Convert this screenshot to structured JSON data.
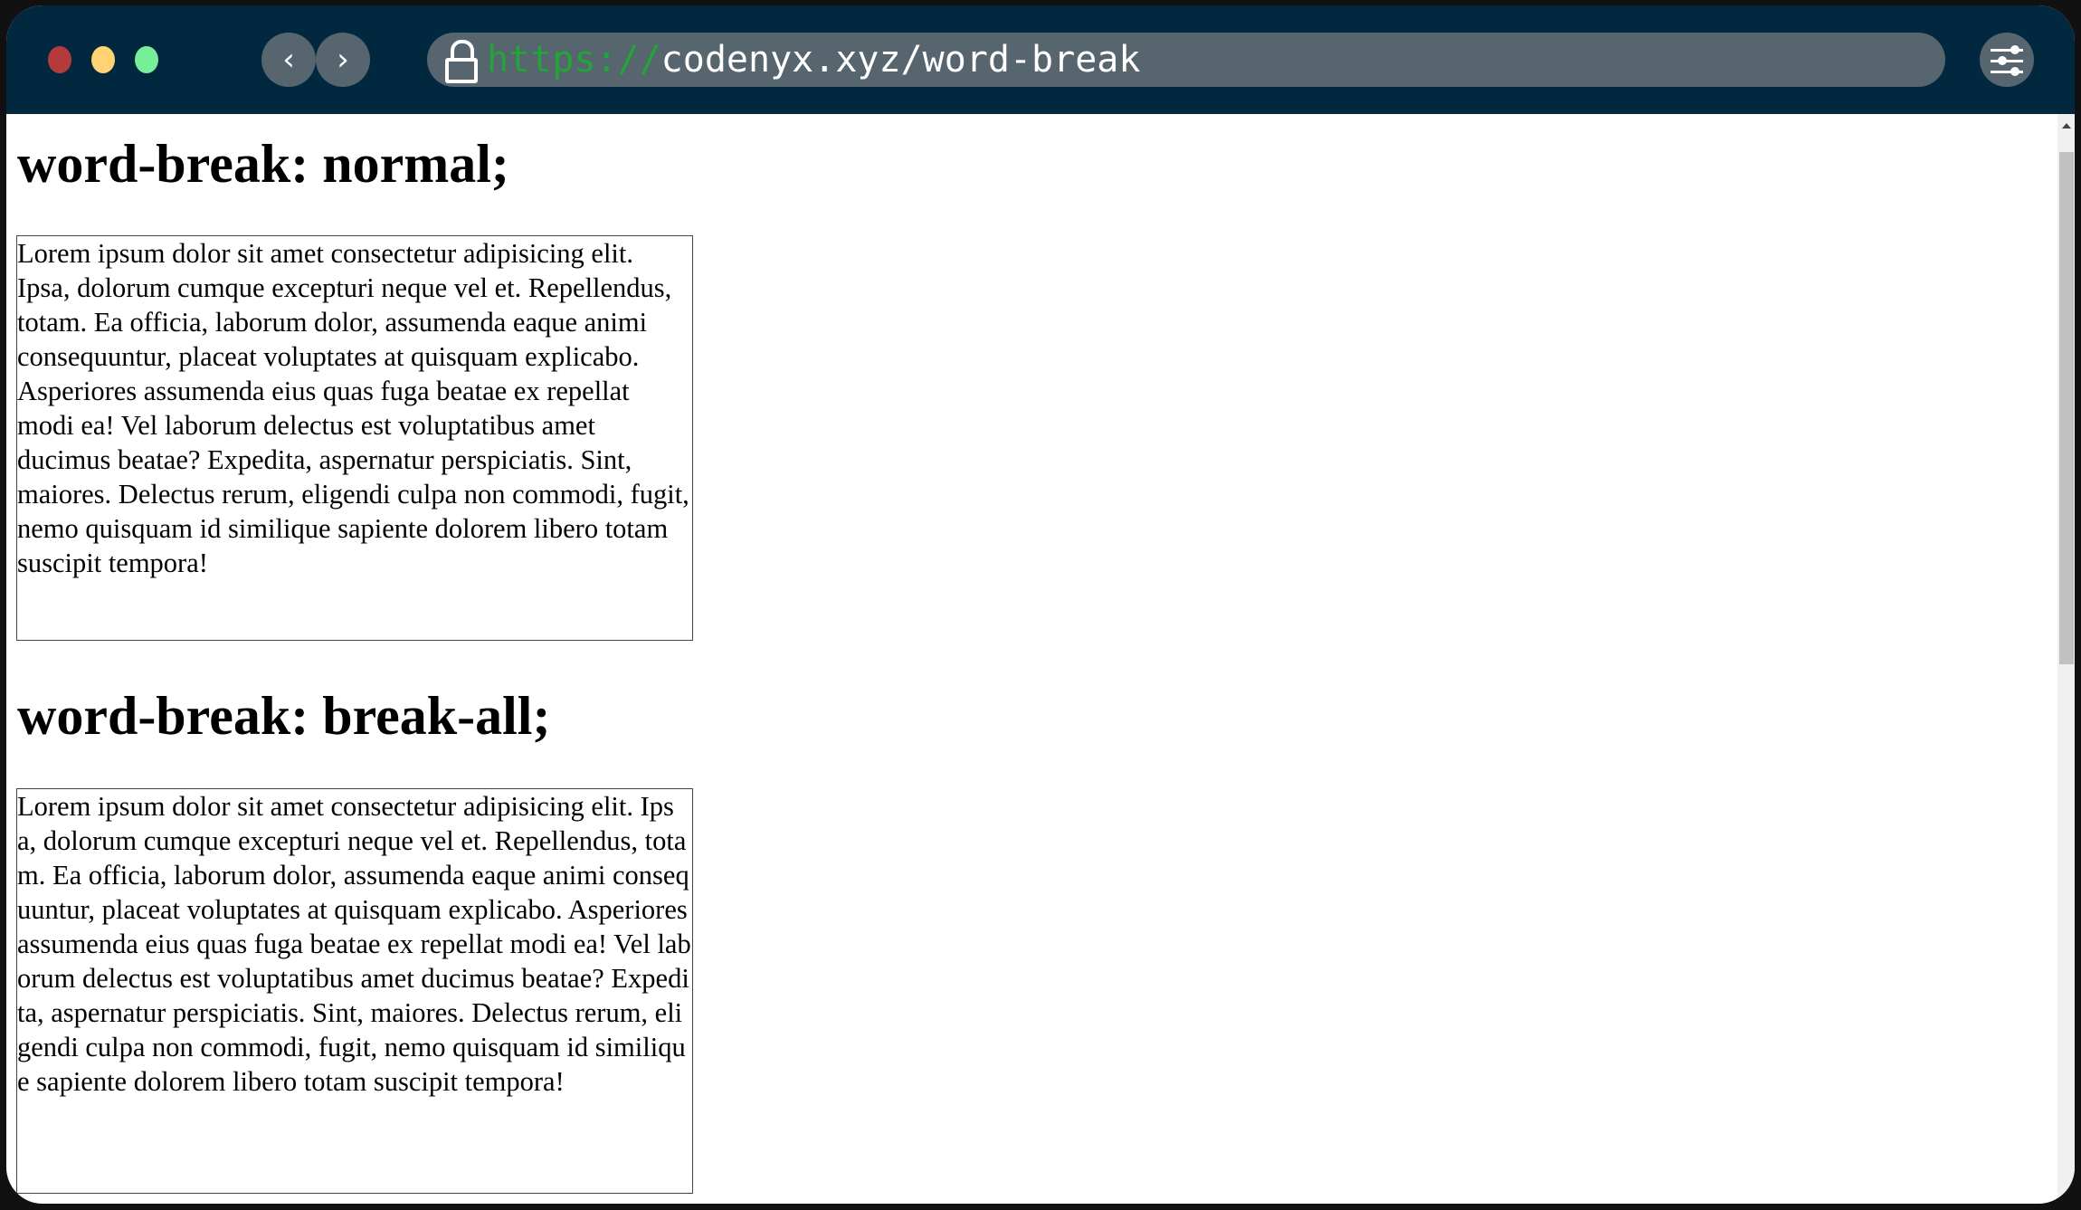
{
  "browser": {
    "url_scheme": "https://",
    "url_rest": "codenyx.xyz/word-break",
    "back_icon": "‹",
    "forward_icon": "›"
  },
  "sections": [
    {
      "heading": "word-break: normal;",
      "text": "Lorem ipsum dolor sit amet consectetur adipisicing elit. Ipsa, dolorum cumque excepturi neque vel et. Repellendus, totam. Ea officia, laborum dolor, assumenda eaque animi consequuntur, placeat voluptates at quisquam explicabo. Asperiores assumenda eius quas fuga beatae ex repellat modi ea! Vel laborum delectus est voluptatibus amet ducimus beatae? Expedita, aspernatur perspiciatis. Sint, maiores. Delectus rerum, eligendi culpa non commodi, fugit, nemo quisquam id similique sapiente dolorem libero totam suscipit tempora!"
    },
    {
      "heading": "word-break: break-all;",
      "text": "Lorem ipsum dolor sit amet consectetur adipisicing elit. Ipsa, dolorum cumque excepturi neque vel et. Repellendus, totam. Ea officia, laborum dolor, assumenda eaque animi consequuntur, placeat voluptates at quisquam explicabo. Asperiores assumenda eius quas fuga beatae ex repellat modi ea! Vel laborum delectus est voluptatibus amet ducimus beatae? Expedita, aspernatur perspiciatis. Sint, maiores. Delectus rerum, eligendi culpa non commodi, fugit, nemo quisquam id similique sapiente dolorem libero totam suscipit tempora!"
    }
  ],
  "colors": {
    "titlebar": "#022840",
    "url_bar": "#56656e",
    "scheme": "#23a33a"
  }
}
